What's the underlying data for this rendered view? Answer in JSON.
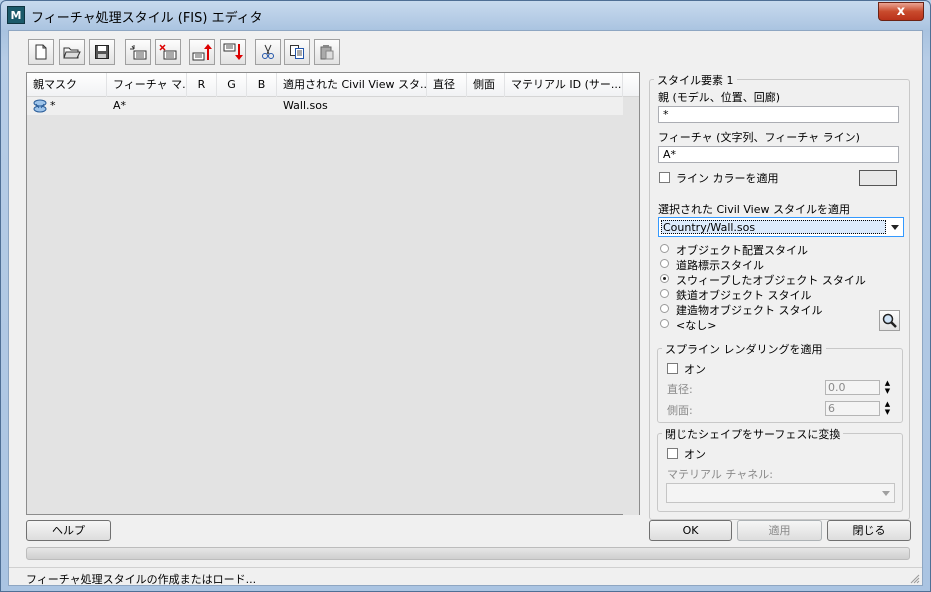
{
  "window": {
    "title": "フィーチャ処理スタイル (FIS) エディタ",
    "icon": "M",
    "close_label": "x"
  },
  "toolbar": {
    "buttons": [
      {
        "name": "new-file-icon"
      },
      {
        "name": "open-folder-icon"
      },
      {
        "name": "save-icon"
      },
      {
        "name": "new-item-icon"
      },
      {
        "name": "delete-item-icon"
      },
      {
        "name": "move-up-icon"
      },
      {
        "name": "move-down-icon"
      },
      {
        "name": "cut-icon"
      },
      {
        "name": "copy-icon"
      },
      {
        "name": "paste-icon"
      }
    ]
  },
  "table": {
    "columns": [
      "親マスク",
      "フィーチャ マ...",
      "R",
      "G",
      "B",
      "適用された Civil View スタ...",
      "直径",
      "側面",
      "マテリアル ID (サー..."
    ],
    "rows": [
      {
        "icon": "style-icon",
        "parent_mask": "*",
        "feature_mask": "A*",
        "r": "",
        "g": "",
        "b": "",
        "style": "Wall.sos",
        "diameter": "",
        "side": "",
        "material_id": ""
      }
    ]
  },
  "style_element": {
    "group_title": "スタイル要素 1",
    "parent_label": "親 (モデル、位置、回廊)",
    "parent_value": "*",
    "feature_label": "フィーチャ (文字列、フィーチャ ライン)",
    "feature_value": "A*",
    "line_color_label": "ライン カラーを適用",
    "line_color_checked": false,
    "line_color": "#e8e8e8",
    "civil_style_label": "選択された Civil View スタイルを適用",
    "civil_style_value": "Country/Wall.sos",
    "style_options": [
      {
        "label": "オブジェクト配置スタイル",
        "selected": false
      },
      {
        "label": "道路標示スタイル",
        "selected": false
      },
      {
        "label": "スウィープしたオブジェクト スタイル",
        "selected": true
      },
      {
        "label": "鉄道オブジェクト スタイル",
        "selected": false
      },
      {
        "label": "建造物オブジェクト スタイル",
        "selected": false
      },
      {
        "label": "<なし>",
        "selected": false
      }
    ],
    "browse_icon": "magnifier-icon"
  },
  "spline": {
    "group_title": "スプライン レンダリングを適用",
    "on_label": "オン",
    "on_checked": false,
    "diameter_label": "直径:",
    "diameter_value": "0.0",
    "side_label": "側面:",
    "side_value": "6"
  },
  "surface": {
    "group_title": "閉じたシェイプをサーフェスに変換",
    "on_label": "オン",
    "on_checked": false,
    "material_label": "マテリアル チャネル:",
    "material_value": ""
  },
  "buttons": {
    "help": "ヘルプ",
    "ok": "OK",
    "apply": "適用",
    "close": "閉じる"
  },
  "status": {
    "text": "フィーチャ処理スタイルの作成またはロード..."
  },
  "progress": {
    "value": 0
  }
}
